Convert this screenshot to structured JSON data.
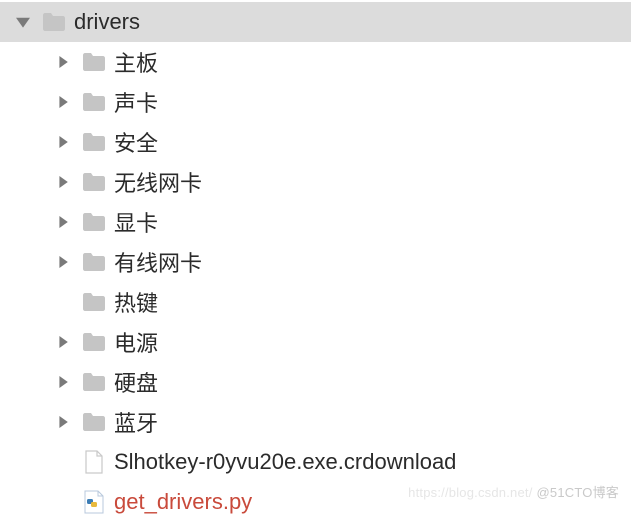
{
  "root": {
    "label": "drivers"
  },
  "children": [
    {
      "label": "主板",
      "icon": "folder",
      "expandable": true
    },
    {
      "label": "声卡",
      "icon": "folder",
      "expandable": true
    },
    {
      "label": "安全",
      "icon": "folder",
      "expandable": true
    },
    {
      "label": "无线网卡",
      "icon": "folder",
      "expandable": true
    },
    {
      "label": "显卡",
      "icon": "folder",
      "expandable": true
    },
    {
      "label": "有线网卡",
      "icon": "folder",
      "expandable": true
    },
    {
      "label": "热键",
      "icon": "folder",
      "expandable": false
    },
    {
      "label": "电源",
      "icon": "folder",
      "expandable": true
    },
    {
      "label": "硬盘",
      "icon": "folder",
      "expandable": true
    },
    {
      "label": "蓝牙",
      "icon": "folder",
      "expandable": true
    },
    {
      "label": "Slhotkey-r0yvu20e.exe.crdownload",
      "icon": "file",
      "expandable": false
    },
    {
      "label": "get_drivers.py",
      "icon": "pyfile",
      "expandable": false
    }
  ],
  "watermark": {
    "blog": "https://blog.csdn.net/",
    "site": "@51CTO博客"
  }
}
